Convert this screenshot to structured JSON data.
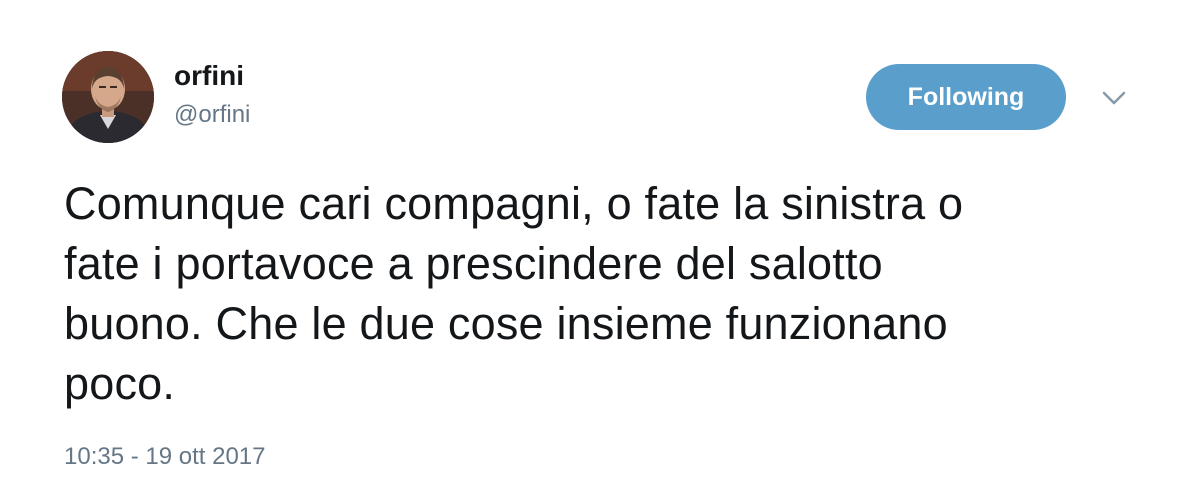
{
  "user": {
    "display_name": "orfini",
    "handle": "@orfini",
    "avatar_icon": "profile-photo"
  },
  "follow_button": {
    "label": "Following",
    "color": "#5a9ecb"
  },
  "menu": {
    "icon": "chevron-down-icon"
  },
  "tweet": {
    "text": "Comunque cari compagni, o fate la sinistra o\nfate i portavoce a prescindere del salotto\nbuono. Che le due cose insieme funzionano\npoco.",
    "timestamp": "10:35 - 19 ott 2017"
  }
}
